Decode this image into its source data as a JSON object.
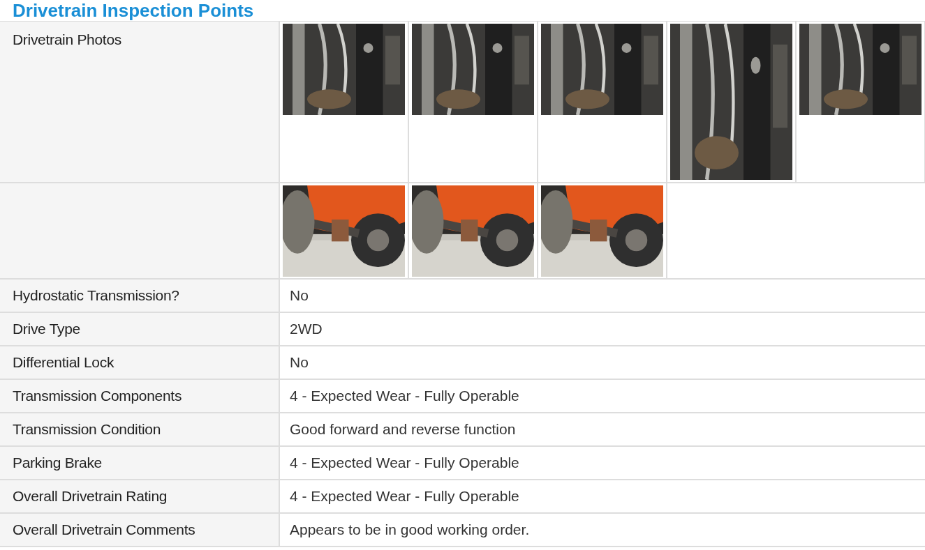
{
  "section_title": "Drivetrain Inspection Points",
  "photo_rows": [
    {
      "label": "Drivetrain Photos",
      "photos": [
        {
          "kind": "picture"
        },
        {
          "kind": "picture"
        },
        {
          "kind": "picture"
        },
        {
          "kind": "picture"
        },
        {
          "kind": "picture"
        }
      ]
    },
    {
      "photos": [
        {
          "kind": "picture"
        },
        {
          "kind": "picture"
        },
        {
          "kind": "picture"
        }
      ]
    }
  ],
  "fields": [
    {
      "label": "Hydrostatic Transmission?",
      "value": "No"
    },
    {
      "label": "Drive Type",
      "value": "2WD"
    },
    {
      "label": "Differential Lock",
      "value": "No"
    },
    {
      "label": "Transmission Components",
      "value": "4 - Expected Wear - Fully Operable"
    },
    {
      "label": "Transmission Condition",
      "value": "Good forward and reverse function"
    },
    {
      "label": "Parking Brake",
      "value": "4 - Expected Wear - Fully Operable"
    },
    {
      "label": "Overall Drivetrain Rating",
      "value": "4 - Expected Wear - Fully Operable"
    },
    {
      "label": "Overall Drivetrain Comments",
      "value": "Appears to be in good working order."
    }
  ]
}
